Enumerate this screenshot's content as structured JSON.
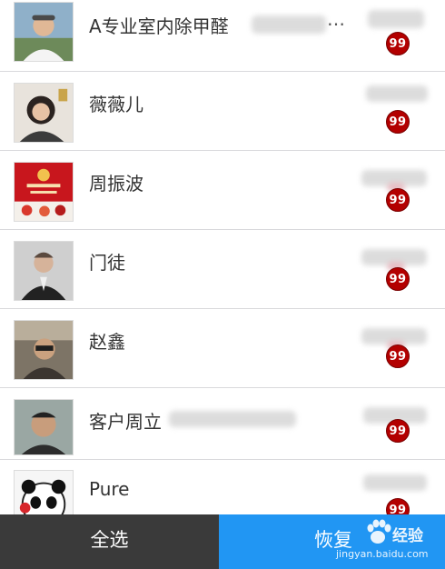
{
  "contacts": [
    {
      "name": "A专业室内除甲醛",
      "name_suffix": "…",
      "avatar_icon": "user-avatar-man-white-shirt",
      "badge": "99"
    },
    {
      "name": "薇薇儿",
      "name_suffix": "",
      "avatar_icon": "user-avatar-woman-dark-hair",
      "badge": "99"
    },
    {
      "name": "周振波",
      "name_suffix": "",
      "avatar_icon": "user-avatar-red-logo",
      "badge": "99"
    },
    {
      "name": "门徒",
      "name_suffix": "",
      "avatar_icon": "user-avatar-man-suit",
      "badge": "99"
    },
    {
      "name": "赵鑫",
      "name_suffix": "",
      "avatar_icon": "user-avatar-person-indoor",
      "badge": "99"
    },
    {
      "name": "客户周立",
      "name_suffix": "",
      "avatar_icon": "user-avatar-man-face",
      "badge": "99"
    },
    {
      "name": "Pure",
      "name_suffix": "",
      "avatar_icon": "user-avatar-panda-cartoon",
      "badge": "99"
    }
  ],
  "bottom_bar": {
    "select_all_label": "全选",
    "restore_label": "恢复"
  },
  "watermark": {
    "brand": "经验",
    "url": "jingyan.baidu.com"
  },
  "colors": {
    "badge": "#b30000",
    "select_all_bg": "#3a3a3a",
    "restore_bg": "#2196f3"
  }
}
